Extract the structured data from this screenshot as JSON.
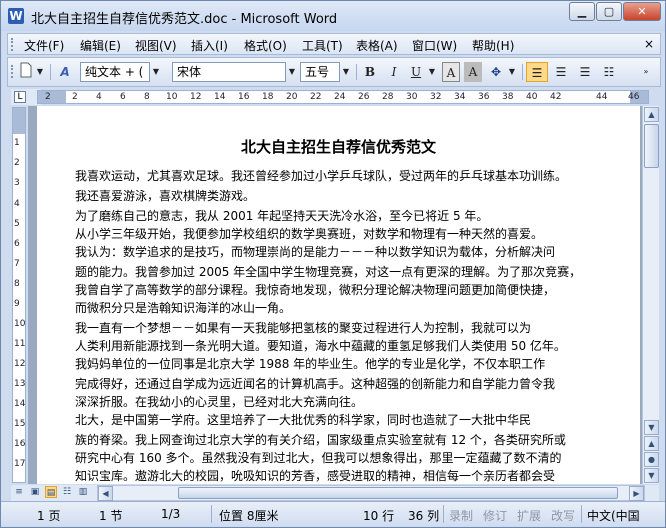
{
  "window": {
    "title": "北大自主招生自荐信优秀范文.doc - Microsoft Word"
  },
  "menu": {
    "items": [
      "文件(F)",
      "编辑(E)",
      "视图(V)",
      "插入(I)",
      "格式(O)",
      "工具(T)",
      "表格(A)",
      "窗口(W)",
      "帮助(H)"
    ],
    "close_doc": "×"
  },
  "toolbar": {
    "style_value": "纯文本 + (",
    "font_value": "宋体",
    "size_value": "五号",
    "bold_label": "B",
    "italic_label": "I",
    "underline_label": "U"
  },
  "ruler": {
    "h_ticks": [
      "2",
      "2",
      "4",
      "6",
      "8",
      "10",
      "12",
      "14",
      "16",
      "18",
      "20",
      "22",
      "24",
      "26",
      "28",
      "30",
      "32",
      "34",
      "36",
      "38",
      "40",
      "42",
      "44",
      "46"
    ],
    "v_ticks": [
      "1",
      "2",
      "3",
      "4",
      "5",
      "6",
      "7",
      "8",
      "9",
      "10",
      "11",
      "12",
      "13",
      "14",
      "15",
      "16",
      "17"
    ]
  },
  "document": {
    "title": "北大自主招生自荐信优秀范文",
    "lines": [
      "我喜欢运动，尤其喜欢足球。我还曾经参加过小学乒乓球队，受过两年的乒乓球基本功训练。",
      "我还喜爱游泳，喜欢棋牌类游戏。",
      "    为了磨练自己的意志，我从 2001 年起坚持天天洗冷水浴，至今已将近 5 年。",
      "    从小学三年级开始，我便参加学校组织的数学奥赛班，对数学和物理有一种天然的喜爱。",
      "我认为：数学追求的是技巧，而物理崇尚的是能力－－－种以数学知识为载体，分析解决问",
      "题的能力。我曾参加过 2005 年全国中学生物理竞赛，对这一点有更深的理解。为了那次竞赛，",
      "我曾自学了高等数学的部分课程。我惊奇地发现，微积分理论解决物理问题更加简便快捷，",
      "而微积分只是浩翰知识海洋的冰山一角。",
      "    我一直有一个梦想－－如果有一天我能够把氢核的聚变过程进行人为控制，我就可以为",
      "人类利用新能源找到一条光明大道。要知道，海水中蕴藏的重氢足够我们人类使用 50 亿年。",
      "    我妈妈单位的一位同事是北京大学 1988 年的毕业生。他学的专业是化学，不仅本职工作",
      "完成得好，还通过自学成为远近闻名的计算机高手。这种超强的创新能力和自学能力曾令我",
      "深深折服。在我幼小的心灵里，已经对北大充满向往。",
      "    北大，是中国第一学府。这里培养了一大批优秀的科学家，同时也造就了一大批中华民",
      "族的脊梁。我上网查询过北京大学的有关介绍，国家级重点实验室就有 12 个，各类研究所或",
      "研究中心有 160 多个。虽然我没有到过北大，但我可以想象得出，那里一定蕴藏了数不清的",
      "知识宝库。遨游北大的校园，吮吸知识的芳香，感受进取的精神，相信每一个亲历者都会受"
    ]
  },
  "status": {
    "page": "1 页",
    "section": "1 节",
    "page_of": "1/3",
    "position": "位置 8厘米",
    "line": "10 行",
    "column": "36 列",
    "rec": "录制",
    "trk": "修订",
    "ext": "扩展",
    "ovr": "改写",
    "language": "中文(中国"
  }
}
